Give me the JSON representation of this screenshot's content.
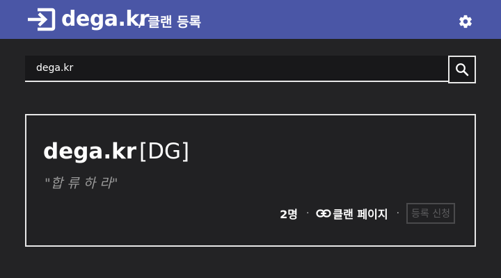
{
  "header": {
    "brand": "dega.kr",
    "breadcrumb": "/ 클랜 등록",
    "logo_icon": "login-arrow-icon",
    "settings_icon": "gear-icon",
    "background": "#4a56a6"
  },
  "search": {
    "value": "dega.kr",
    "placeholder": "",
    "button_icon": "search-icon"
  },
  "clan": {
    "name": "dega.kr",
    "tag": "[DG]",
    "motto": "\"합 류 하 라\"",
    "members": "2명",
    "separator": "·",
    "link_label": "클랜 페이지",
    "link_icon": "link-icon",
    "register_label": "등록 신청"
  },
  "colors": {
    "page_background": "#232325",
    "border": "#e8e8e8",
    "muted_text": "#9a9a9a",
    "disabled_button": "#5c5c5e"
  }
}
